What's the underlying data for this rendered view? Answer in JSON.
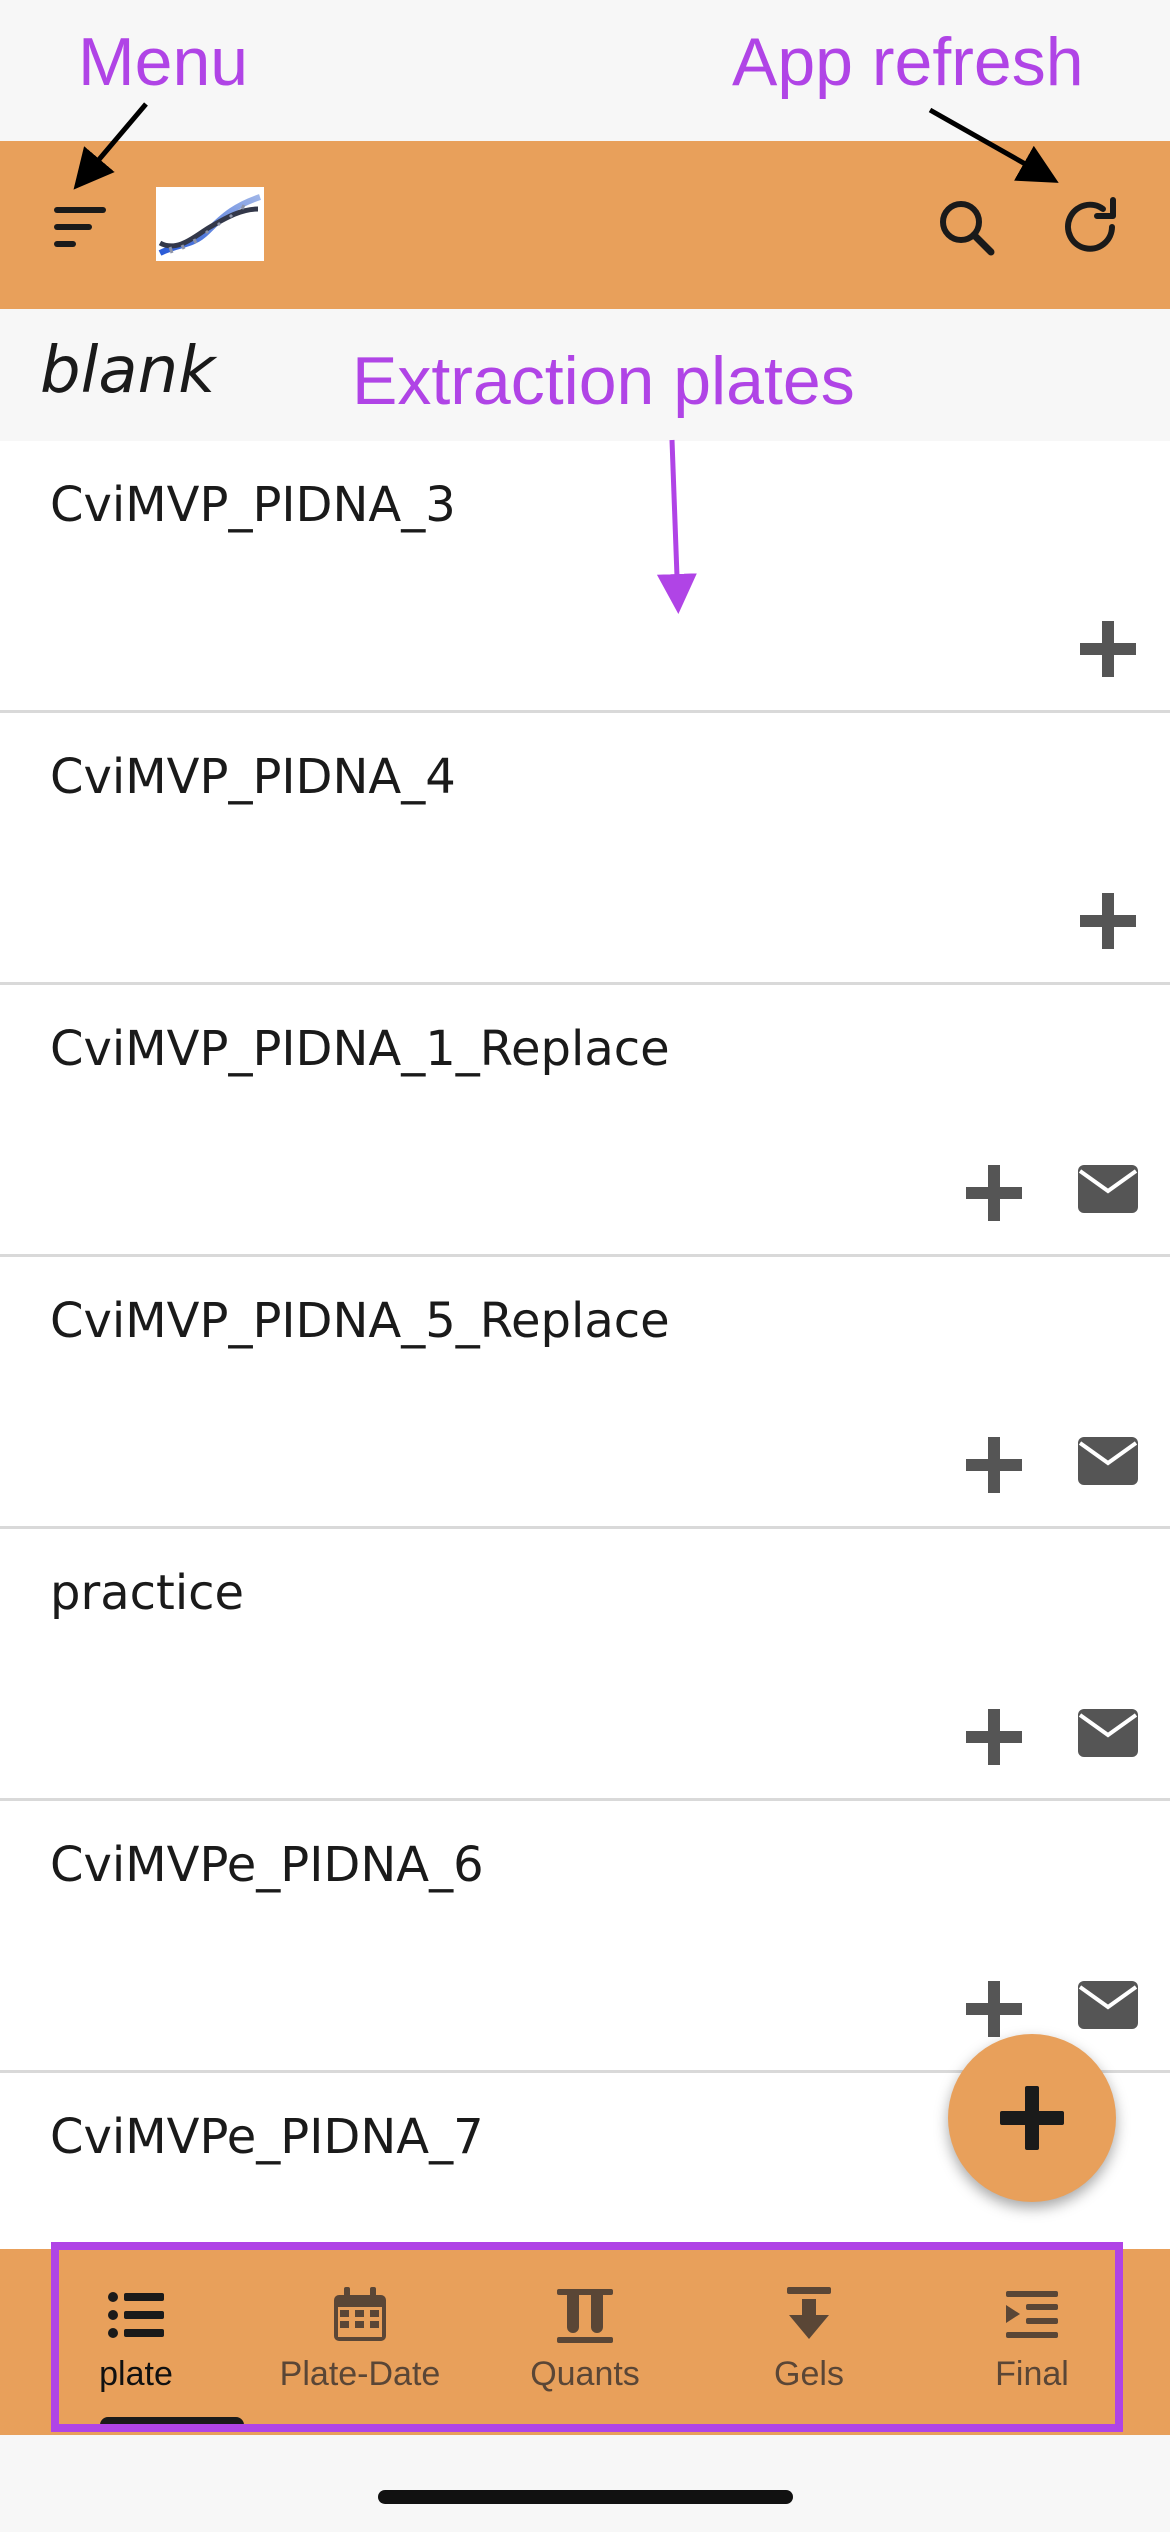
{
  "annotations": {
    "menu": "Menu",
    "refresh": "App refresh",
    "plates": "Extraction plates"
  },
  "header": {
    "icons": [
      "menu-icon",
      "dna-logo",
      "search-icon",
      "refresh-icon"
    ],
    "accent_color": "#e8a05b"
  },
  "subheader": {
    "title": "blank"
  },
  "plates": [
    {
      "name": "CviMVP_PIDNA_3",
      "email": false
    },
    {
      "name": "CviMVP_PIDNA_4",
      "email": false
    },
    {
      "name": "CviMVP_PIDNA_1_Replace",
      "email": true
    },
    {
      "name": "CviMVP_PIDNA_5_Replace",
      "email": true
    },
    {
      "name": "practice",
      "email": true
    },
    {
      "name": "CviMVPe_PIDNA_6",
      "email": true
    },
    {
      "name": "CviMVPe_PIDNA_7",
      "email": false
    }
  ],
  "fab": {
    "icon": "plus-icon"
  },
  "bottom_nav": {
    "items": [
      {
        "label": "plate",
        "icon": "list-icon",
        "active": true
      },
      {
        "label": "Plate-Date",
        "icon": "calendar-icon",
        "active": false
      },
      {
        "label": "Quants",
        "icon": "test-tubes-icon",
        "active": false
      },
      {
        "label": "Gels",
        "icon": "download-icon",
        "active": false
      },
      {
        "label": "Final",
        "icon": "indent-icon",
        "active": false
      }
    ]
  },
  "colors": {
    "annotation": "#b044e6",
    "header": "#e8a05b",
    "icon": "#5a5a5a"
  }
}
